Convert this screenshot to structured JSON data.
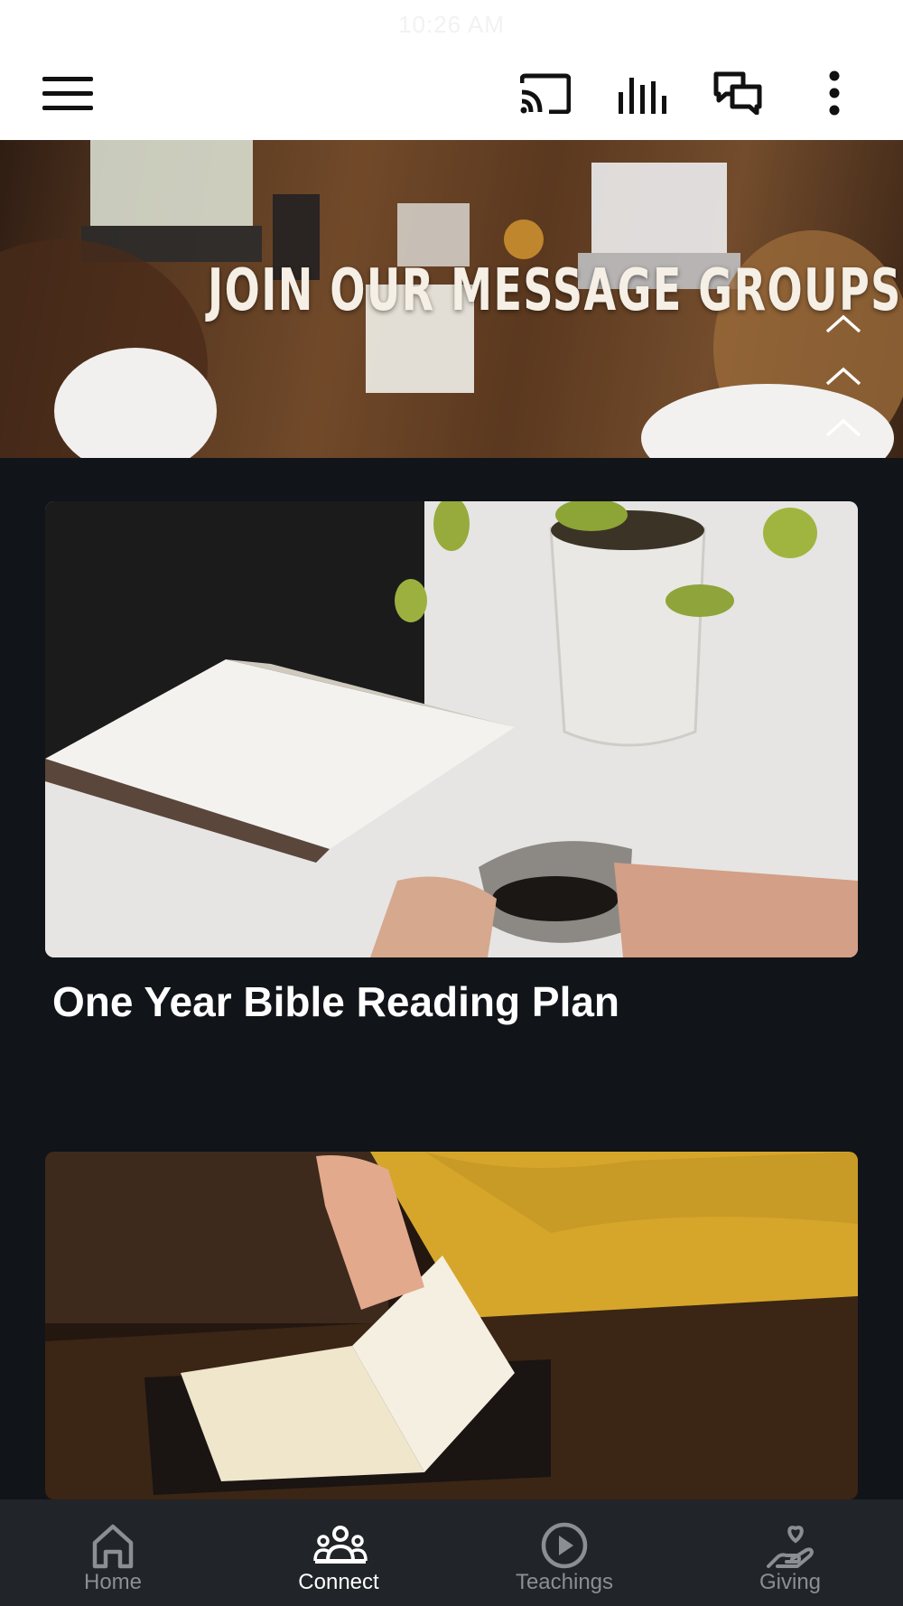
{
  "status_bar": {
    "time": "10:26 AM"
  },
  "toolbar": {
    "buttons": [
      {
        "icon": "menu-icon"
      },
      {
        "icon": "cast-icon"
      },
      {
        "icon": "audio-bars-icon"
      },
      {
        "icon": "chat-icon"
      },
      {
        "icon": "more-vert-icon"
      }
    ]
  },
  "hero": {
    "title": "JOIN OUR MESSAGE GROUPS"
  },
  "cards": [
    {
      "title": "One Year Bible Reading Plan",
      "image": "bible-plant-coffee-photo"
    },
    {
      "title": "",
      "image": "bible-reading-photo"
    }
  ],
  "bottom_nav": {
    "items": [
      {
        "label": "Home",
        "icon": "home-icon",
        "active": false
      },
      {
        "label": "Connect",
        "icon": "people-icon",
        "active": true
      },
      {
        "label": "Teachings",
        "icon": "play-circle-icon",
        "active": false
      },
      {
        "label": "Giving",
        "icon": "giving-hand-icon",
        "active": false
      }
    ]
  },
  "colors": {
    "background": "#111418",
    "toolbar": "#ffffff",
    "nav_background": "#212428",
    "nav_active": "#ffffff",
    "nav_inactive": "#8b8e93"
  }
}
